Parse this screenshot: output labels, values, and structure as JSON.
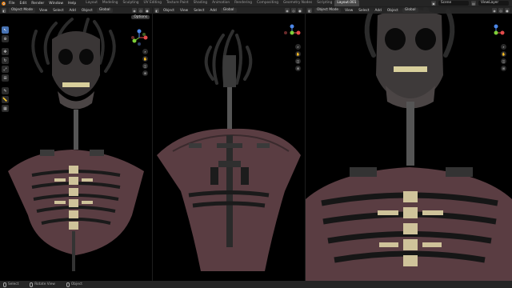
{
  "menu": {
    "items": [
      "File",
      "Edit",
      "Render",
      "Window",
      "Help"
    ]
  },
  "workspaces": {
    "tabs": [
      "Layout",
      "Modeling",
      "Sculpting",
      "UV Editing",
      "Texture Paint",
      "Shading",
      "Animation",
      "Rendering",
      "Compositing",
      "Geometry Nodes",
      "Scripting"
    ],
    "active": "Layout.001"
  },
  "scene": {
    "label": "Scene"
  },
  "viewlayer": {
    "label": "ViewLayer"
  },
  "viewport_header": {
    "mode": "Object Mode",
    "view": "View",
    "select": "Select",
    "add": "Add",
    "object": "Object",
    "transform": "Global",
    "options": "Options"
  },
  "statusbar": {
    "select": "Select",
    "rotate": "Rotate View",
    "object": "Object"
  },
  "colors": {
    "accent": "#4772b3",
    "axis_x": "#e44b4b",
    "axis_y": "#7ed038",
    "axis_z": "#4c87e8",
    "flesh": "#5a3d42",
    "bone": "#cfc39a"
  }
}
